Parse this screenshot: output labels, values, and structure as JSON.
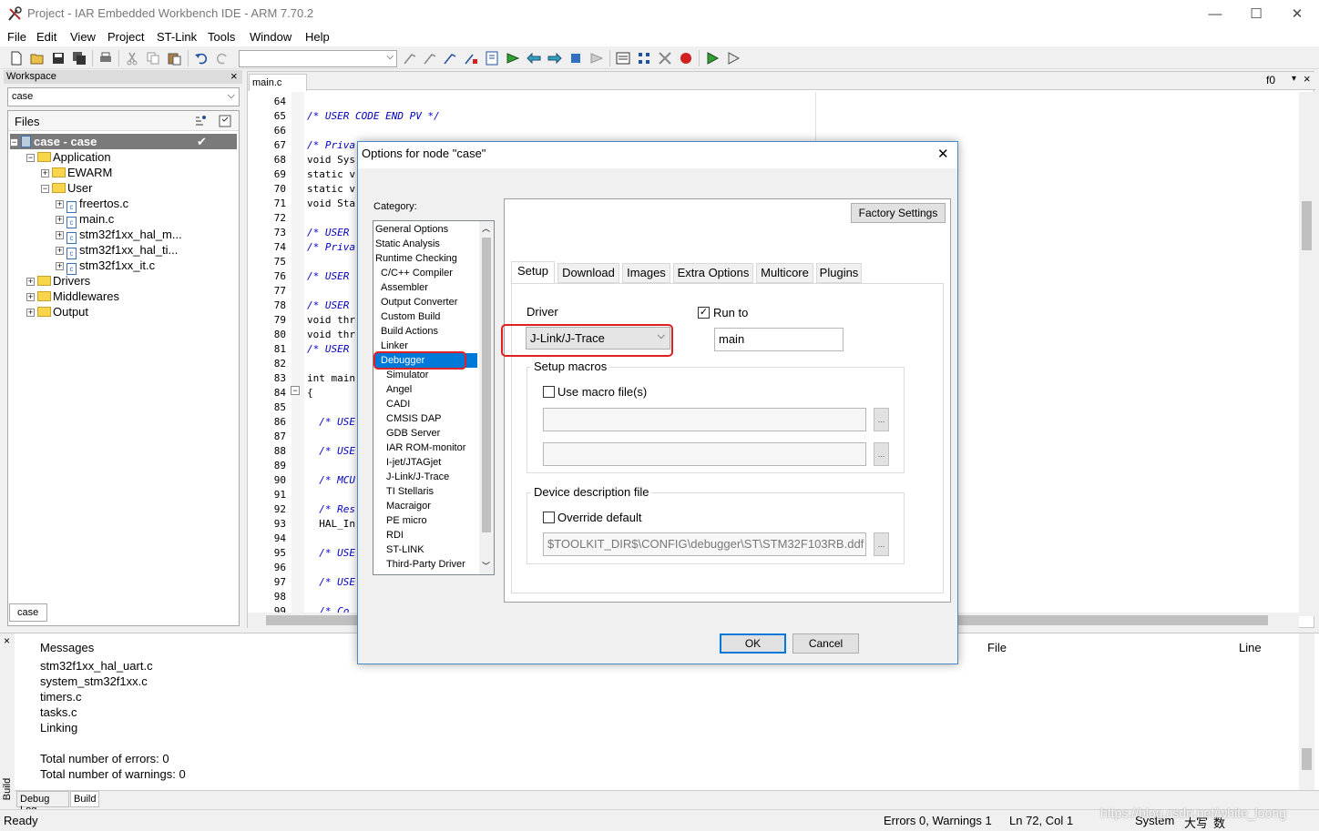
{
  "window": {
    "title": "Project - IAR Embedded Workbench IDE - ARM 7.70.2",
    "min_glyph": "—",
    "max_glyph": "☐",
    "close_glyph": "✕"
  },
  "menu": [
    "File",
    "Edit",
    "View",
    "Project",
    "ST-Link",
    "Tools",
    "Window",
    "Help"
  ],
  "toolbar": {
    "combo_value": ""
  },
  "workspace": {
    "title": "Workspace",
    "close_glyph": "×",
    "config": "case",
    "files_header": "Files",
    "tree": [
      {
        "label": "case - case",
        "selected": true,
        "check": "✔"
      },
      {
        "label": "Application"
      },
      {
        "label": "EWARM"
      },
      {
        "label": "User"
      },
      {
        "label": "freertos.c"
      },
      {
        "label": "main.c"
      },
      {
        "label": "stm32f1xx_hal_m..."
      },
      {
        "label": "stm32f1xx_hal_ti..."
      },
      {
        "label": "stm32f1xx_it.c"
      },
      {
        "label": "Drivers"
      },
      {
        "label": "Middlewares"
      },
      {
        "label": "Output"
      }
    ],
    "bottom_tab": "case"
  },
  "editor": {
    "tab": "main.c",
    "func_label": "f0",
    "lines": [
      {
        "n": "64",
        "t": ""
      },
      {
        "n": "65",
        "t": "/* USER CODE END PV */",
        "cm": true
      },
      {
        "n": "66",
        "t": ""
      },
      {
        "n": "67",
        "t": "/* Priva",
        "cm": true
      },
      {
        "n": "68",
        "t": "void Sys"
      },
      {
        "n": "69",
        "t": "static v"
      },
      {
        "n": "70",
        "t": "static v"
      },
      {
        "n": "71",
        "t": "void Sta"
      },
      {
        "n": "72",
        "t": ""
      },
      {
        "n": "73",
        "t": "/* USER",
        "cm": true
      },
      {
        "n": "74",
        "t": "/* Priva",
        "cm": true
      },
      {
        "n": "75",
        "t": ""
      },
      {
        "n": "76",
        "t": "/* USER",
        "cm": true
      },
      {
        "n": "77",
        "t": ""
      },
      {
        "n": "78",
        "t": "/* USER",
        "cm": true
      },
      {
        "n": "79",
        "t": "void thr"
      },
      {
        "n": "80",
        "t": "void thr"
      },
      {
        "n": "81",
        "t": "/* USER",
        "cm": true
      },
      {
        "n": "82",
        "t": ""
      },
      {
        "n": "83",
        "t": "int main"
      },
      {
        "n": "84",
        "t": "{"
      },
      {
        "n": "85",
        "t": ""
      },
      {
        "n": "86",
        "t": "  /* USE",
        "cm": true
      },
      {
        "n": "87",
        "t": ""
      },
      {
        "n": "88",
        "t": "  /* USE",
        "cm": true
      },
      {
        "n": "89",
        "t": ""
      },
      {
        "n": "90",
        "t": "  /* MCU",
        "cm": true
      },
      {
        "n": "91",
        "t": ""
      },
      {
        "n": "92",
        "t": "  /* Res",
        "cm": true
      },
      {
        "n": "93",
        "t": "  HAL_In"
      },
      {
        "n": "94",
        "t": ""
      },
      {
        "n": "95",
        "t": "  /* USE",
        "cm": true
      },
      {
        "n": "96",
        "t": ""
      },
      {
        "n": "97",
        "t": "  /* USE",
        "cm": true
      },
      {
        "n": "98",
        "t": ""
      },
      {
        "n": "99",
        "t": "  /* Co",
        "cm": true
      }
    ]
  },
  "messages": {
    "header": "Messages",
    "file_col": "File",
    "line_col": "Line",
    "lines": [
      "stm32f1xx_hal_uart.c",
      "system_stm32f1xx.c",
      "timers.c",
      "tasks.c",
      "Linking",
      "",
      "Total number of errors: 0",
      "Total number of warnings: 0"
    ],
    "tabs": [
      "Debug Log",
      "Build"
    ],
    "side_label": "Build"
  },
  "status": {
    "ready": "Ready",
    "errors": "Errors 0, Warnings 1",
    "position": "Ln 72, Col 1",
    "encoding": "System",
    "ime1": "大写",
    "ime2": "数",
    "watermark": "https://blog.csdn.net/white_loong"
  },
  "dialog": {
    "title": "Options for node \"case\"",
    "close_glyph": "✕",
    "category_label": "Category:",
    "categories": [
      {
        "label": "General Options",
        "indent": 0
      },
      {
        "label": "Static Analysis",
        "indent": 0
      },
      {
        "label": "Runtime Checking",
        "indent": 0
      },
      {
        "label": "C/C++ Compiler",
        "indent": 1
      },
      {
        "label": "Assembler",
        "indent": 1
      },
      {
        "label": "Output Converter",
        "indent": 1
      },
      {
        "label": "Custom Build",
        "indent": 1
      },
      {
        "label": "Build Actions",
        "indent": 1
      },
      {
        "label": "Linker",
        "indent": 1
      },
      {
        "label": "Debugger",
        "indent": 1,
        "selected": true
      },
      {
        "label": "Simulator",
        "indent": 2
      },
      {
        "label": "Angel",
        "indent": 2
      },
      {
        "label": "CADI",
        "indent": 2
      },
      {
        "label": "CMSIS DAP",
        "indent": 2
      },
      {
        "label": "GDB Server",
        "indent": 2
      },
      {
        "label": "IAR ROM-monitor",
        "indent": 2
      },
      {
        "label": "I-jet/JTAGjet",
        "indent": 2
      },
      {
        "label": "J-Link/J-Trace",
        "indent": 2
      },
      {
        "label": "TI Stellaris",
        "indent": 2
      },
      {
        "label": "Macraigor",
        "indent": 2
      },
      {
        "label": "PE micro",
        "indent": 2
      },
      {
        "label": "RDI",
        "indent": 2
      },
      {
        "label": "ST-LINK",
        "indent": 2
      },
      {
        "label": "Third-Party Driver",
        "indent": 2
      }
    ],
    "factory_settings": "Factory Settings",
    "tabs": [
      "Setup",
      "Download",
      "Images",
      "Extra Options",
      "Multicore",
      "Plugins"
    ],
    "driver_label": "Driver",
    "driver_value": "J-Link/J-Trace",
    "run_to_label": "Run to",
    "run_to_checked": true,
    "run_to_value": "main",
    "setup_macros_label": "Setup macros",
    "use_macro_label": "Use macro file(s)",
    "macro_file1": "",
    "macro_file2": "",
    "device_desc_label": "Device description file",
    "override_label": "Override default",
    "device_file": "$TOOLKIT_DIR$\\CONFIG\\debugger\\ST\\STM32F103RB.ddf",
    "browse_glyph": "...",
    "ok": "OK",
    "cancel": "Cancel",
    "highlight_color": "#e02020"
  },
  "colors": {
    "accent": "#0078d7",
    "comment": "#0000c0",
    "folder": "#f8d64c"
  }
}
